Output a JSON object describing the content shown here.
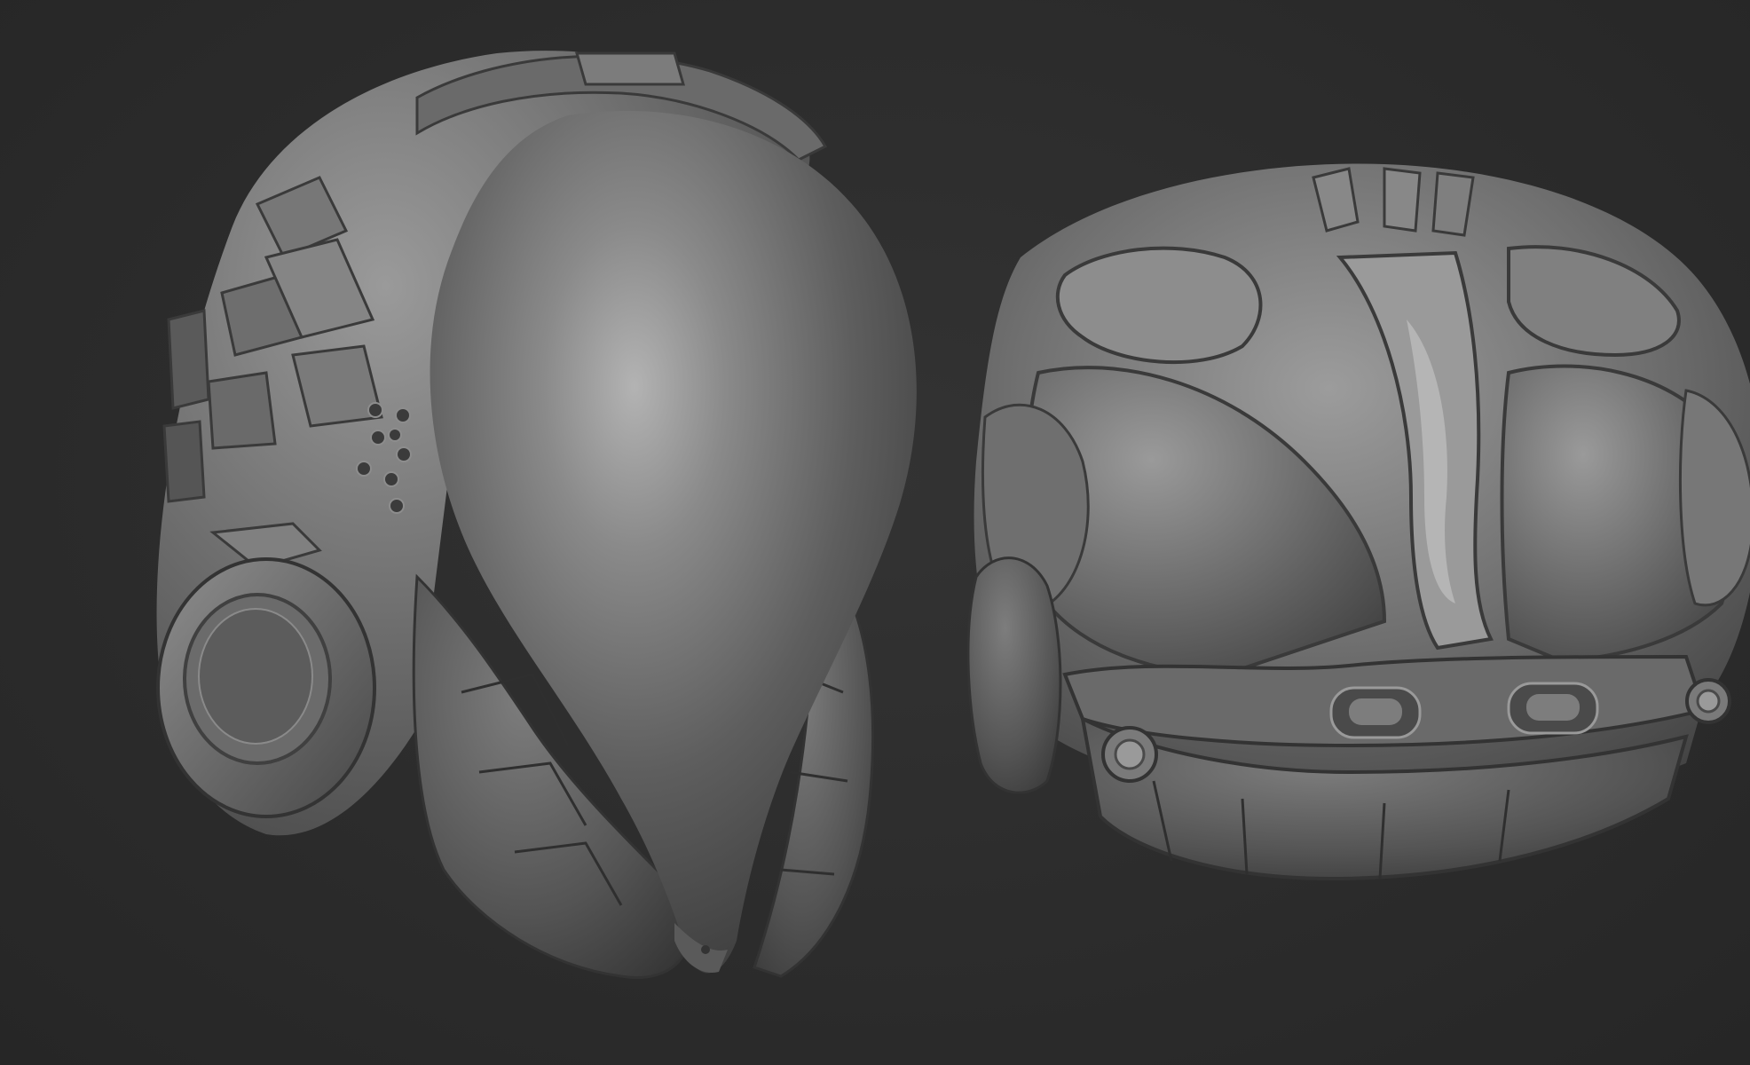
{
  "scene": {
    "background_color": "#2b2b2b",
    "material_color": "#7a7a7a",
    "objects": [
      {
        "name": "helmet-side-view",
        "description_icon": "helmet-side-icon"
      },
      {
        "name": "helmet-front-view",
        "description_icon": "helmet-front-icon"
      }
    ]
  }
}
